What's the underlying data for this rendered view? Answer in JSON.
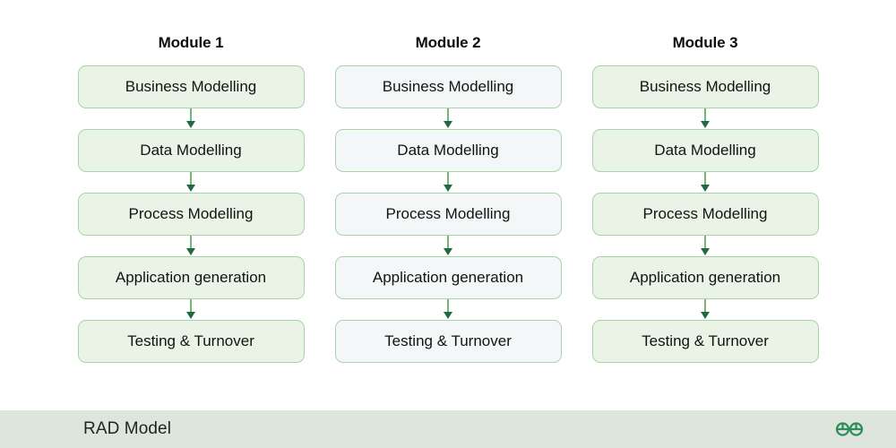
{
  "diagram": {
    "stage_labels": [
      "Business Modelling",
      "Data Modelling",
      "Process Modelling",
      "Application generation",
      "Testing & Turnover"
    ],
    "columns": [
      {
        "title": "Module 1",
        "fill_style": "green",
        "box_fill": "#e9f4e6",
        "border_color": "#a9d2a6",
        "stages": [
          "Business Modelling",
          "Data Modelling",
          "Process Modelling",
          "Application generation",
          "Testing & Turnover"
        ]
      },
      {
        "title": "Module 2",
        "fill_style": "light",
        "box_fill": "#f4f7f7",
        "border_color": "#a9d2a6",
        "stages": [
          "Business Modelling",
          "Data Modelling",
          "Process Modelling",
          "Application generation",
          "Testing & Turnover"
        ]
      },
      {
        "title": "Module 3",
        "fill_style": "green",
        "box_fill": "#e9f4e6",
        "border_color": "#a9d2a6",
        "stages": [
          "Business Modelling",
          "Data Modelling",
          "Process Modelling",
          "Application generation",
          "Testing & Turnover"
        ]
      }
    ],
    "arrow_color": "#1f6b41",
    "connector_line_color": "#77b376"
  },
  "footer": {
    "caption": "RAD Model",
    "background_color": "#dde5dd",
    "logo": {
      "icon": "geeksforgeeks-logo-icon",
      "color": "#2f8d5b"
    }
  }
}
